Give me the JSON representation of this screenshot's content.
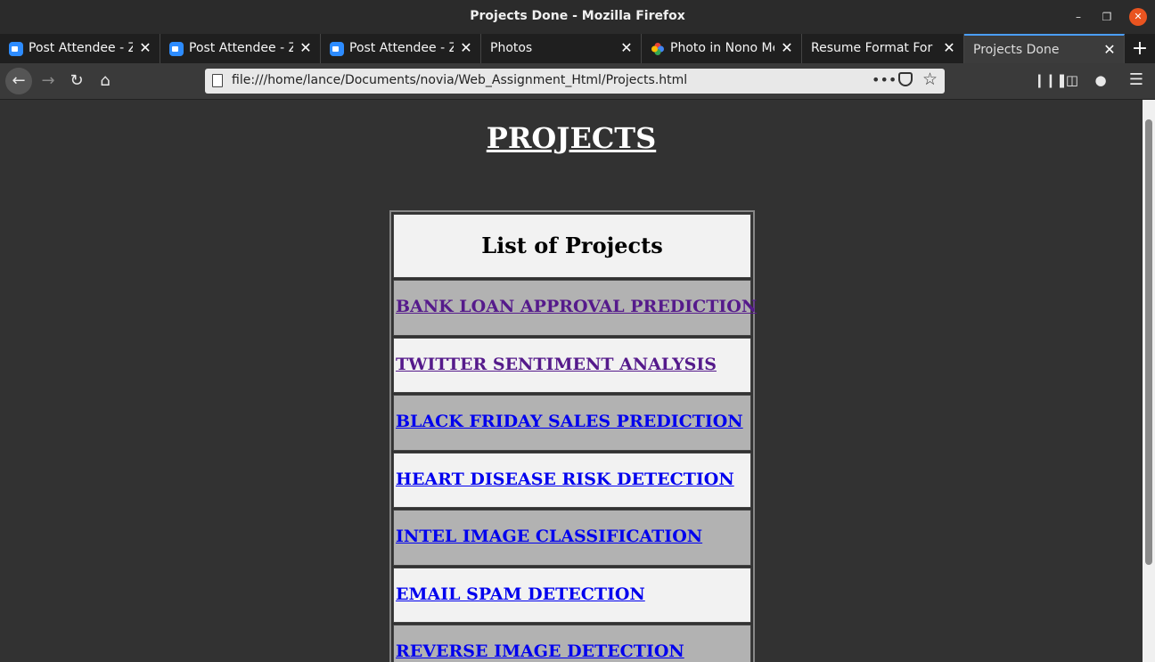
{
  "window": {
    "title": "Projects Done - Mozilla Firefox"
  },
  "tabs": [
    {
      "label": "Post Attendee - Zoom",
      "icon": "zoom-icon"
    },
    {
      "label": "Post Attendee - Zoom",
      "icon": "zoom-icon"
    },
    {
      "label": "Post Attendee - Zoom",
      "icon": "zoom-icon"
    },
    {
      "label": "Photos",
      "icon": ""
    },
    {
      "label": "Photo in Nono Me",
      "icon": "google-photos-icon"
    },
    {
      "label": "Resume Format For",
      "icon": ""
    },
    {
      "label": "Projects Done",
      "icon": ""
    }
  ],
  "navbar": {
    "url": "file:///home/lance/Documents/novia/Web_Assignment_Html/Projects.html"
  },
  "page": {
    "heading": "PROJECTS",
    "table_header": "List of Projects",
    "projects": [
      {
        "label": "BANK LOAN APPROVAL PREDICTION",
        "visited": true
      },
      {
        "label": "TWITTER SENTIMENT ANALYSIS",
        "visited": true
      },
      {
        "label": "BLACK FRIDAY SALES PREDICTION",
        "visited": false
      },
      {
        "label": "HEART DISEASE RISK DETECTION",
        "visited": false
      },
      {
        "label": "INTEL IMAGE CLASSIFICATION",
        "visited": false
      },
      {
        "label": "EMAIL SPAM DETECTION",
        "visited": false
      },
      {
        "label": "REVERSE IMAGE DETECTION",
        "visited": false
      }
    ]
  },
  "colors": {
    "page_bg": "#323232",
    "cell_light": "#f2f2f2",
    "cell_dark": "#b2b2b2",
    "visited_link": "#551a8b",
    "link": "#0000ee"
  }
}
